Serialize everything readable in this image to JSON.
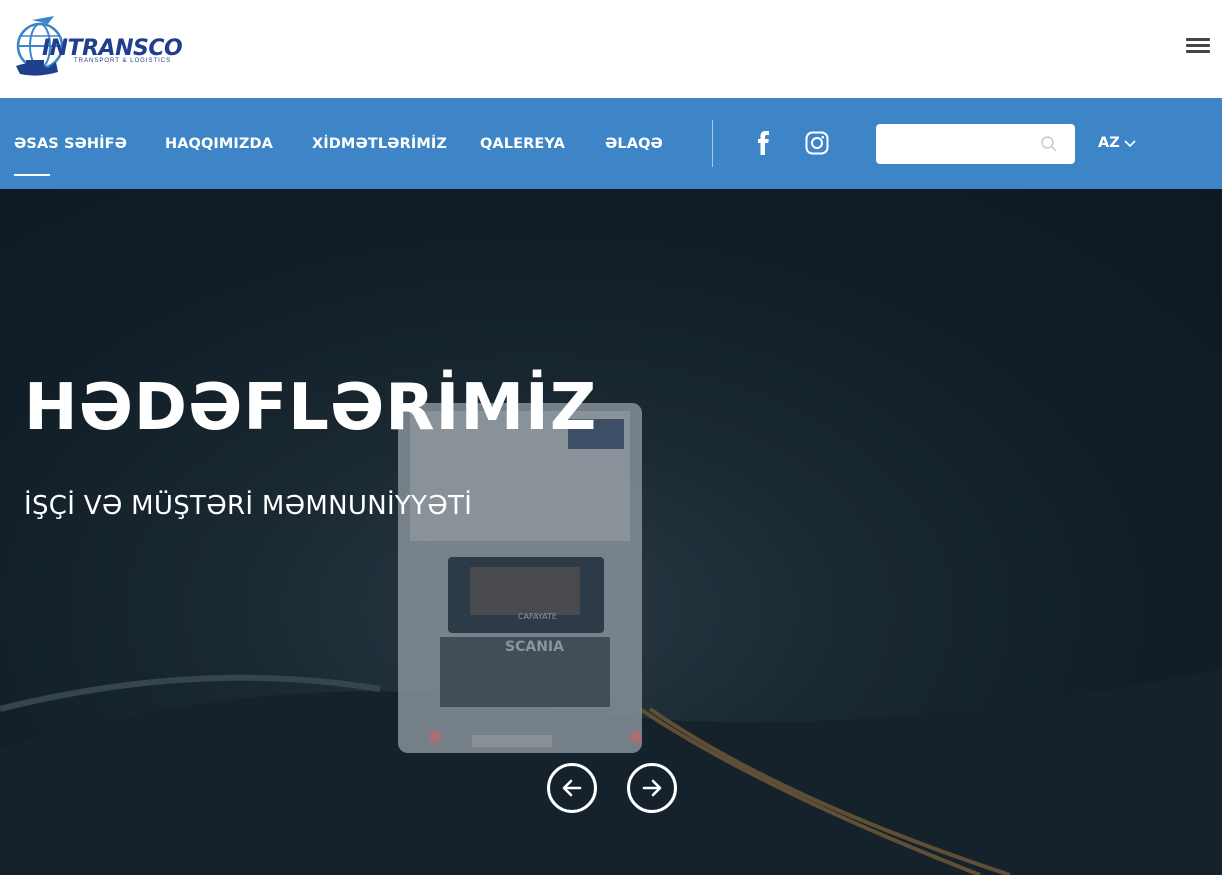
{
  "brand": {
    "name": "INTRANSCO",
    "tagline": "TRANSPORT & LOGISTICS"
  },
  "nav": {
    "items": [
      {
        "label": "ƏSAS SƏHİFƏ",
        "active": true
      },
      {
        "label": "HAQQIMIZDA",
        "active": false
      },
      {
        "label": "XİDMƏTLƏRİMİZ",
        "active": false
      },
      {
        "label": "QALEREYA",
        "active": false
      },
      {
        "label": "ƏLAQƏ",
        "active": false
      }
    ],
    "social": [
      "facebook-icon",
      "instagram-icon"
    ],
    "search": {
      "value": "",
      "placeholder": ""
    },
    "language": "AZ"
  },
  "hero": {
    "title": "HƏDƏFLƏRİMİZ",
    "subtitle": "İŞÇİ VƏ MÜŞTƏRİ MƏMNUNİYYƏTİ",
    "truck_text": {
      "grille": "SCANIA",
      "windshield": "CAFAYATE"
    }
  },
  "colors": {
    "navbar": "#3d85c6",
    "brand": "#1f3e8c",
    "hero_overlay": "#0d1c26"
  }
}
